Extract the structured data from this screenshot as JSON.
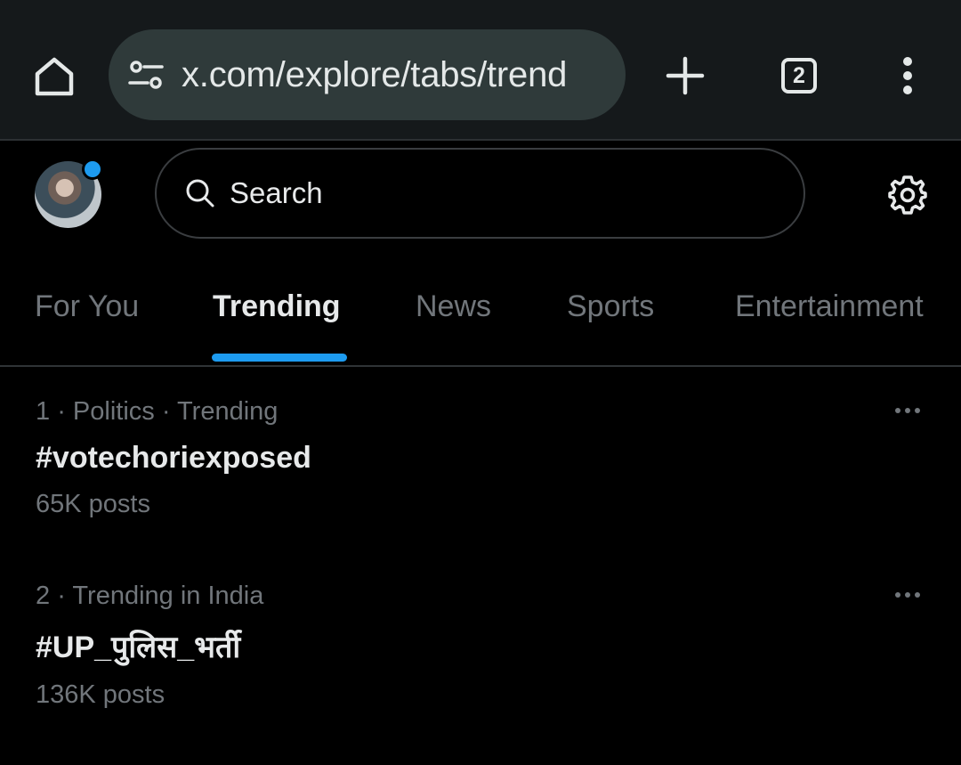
{
  "browser": {
    "url": "x.com/explore/tabs/trend",
    "tab_count": "2"
  },
  "search": {
    "placeholder": "Search"
  },
  "tabs": [
    {
      "label": "For You"
    },
    {
      "label": "Trending"
    },
    {
      "label": "News"
    },
    {
      "label": "Sports"
    },
    {
      "label": "Entertainment"
    }
  ],
  "trends": [
    {
      "rank": "1",
      "context": "Politics · Trending",
      "name": "#votechoriexposed",
      "posts": "65K posts"
    },
    {
      "rank": "2",
      "context": "Trending in India",
      "name": "#UP_पुलिस_भर्ती",
      "posts": "136K posts"
    }
  ],
  "colors": {
    "accent": "#1d9bf0",
    "background": "#000000",
    "chrome": "#15191b",
    "muted_text": "#71767b"
  }
}
